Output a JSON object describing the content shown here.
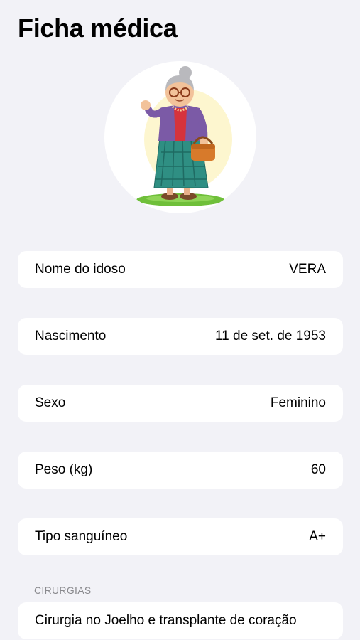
{
  "page": {
    "title": "Ficha médica"
  },
  "avatar": {
    "icon": "grandmother-illustration"
  },
  "fields": [
    {
      "label": "Nome do idoso",
      "value": "VERA"
    },
    {
      "label": "Nascimento",
      "value": "11 de set. de 1953"
    },
    {
      "label": "Sexo",
      "value": "Feminino"
    },
    {
      "label": "Peso (kg)",
      "value": "60"
    },
    {
      "label": "Tipo sanguíneo",
      "value": "A+"
    }
  ],
  "surgeries": {
    "header": "CIRURGIAS",
    "text": "Cirurgia no Joelho e transplante de coração"
  },
  "colors": {
    "background": "#f2f2f7",
    "card": "#ffffff",
    "section_header": "#8a8a8e"
  }
}
